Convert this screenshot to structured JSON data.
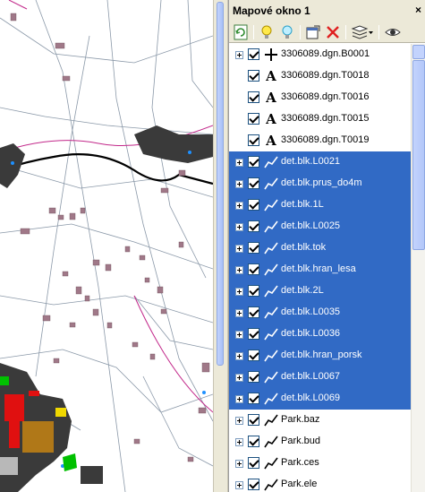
{
  "panel": {
    "title": "Mapové okno 1",
    "close_symbol": "×"
  },
  "toolbar": {
    "buttons": [
      {
        "name": "refresh-icon"
      },
      {
        "name": "lightbulb-on-icon"
      },
      {
        "name": "lightbulb-off-icon"
      },
      {
        "name": "properties-icon"
      },
      {
        "name": "delete-icon"
      },
      {
        "name": "layers-dropdown-icon"
      },
      {
        "name": "eye-icon"
      }
    ]
  },
  "layers": [
    {
      "label": "3306089.dgn.B0001",
      "icon": "point-cross-icon",
      "expandable": true,
      "checked": true,
      "selected": false
    },
    {
      "label": "3306089.dgn.T0018",
      "icon": "text-layer-icon",
      "expandable": false,
      "checked": true,
      "selected": false
    },
    {
      "label": "3306089.dgn.T0016",
      "icon": "text-layer-icon",
      "expandable": false,
      "checked": true,
      "selected": false
    },
    {
      "label": "3306089.dgn.T0015",
      "icon": "text-layer-icon",
      "expandable": false,
      "checked": true,
      "selected": false
    },
    {
      "label": "3306089.dgn.T0019",
      "icon": "text-layer-icon",
      "expandable": false,
      "checked": true,
      "selected": false
    },
    {
      "label": "det.blk.L0021",
      "icon": "line-layer-icon",
      "expandable": true,
      "checked": true,
      "selected": true
    },
    {
      "label": "det.blk.prus_do4m",
      "icon": "line-layer-icon",
      "expandable": true,
      "checked": true,
      "selected": true
    },
    {
      "label": "det.blk.1L",
      "icon": "line-layer-icon",
      "expandable": true,
      "checked": true,
      "selected": true
    },
    {
      "label": "det.blk.L0025",
      "icon": "line-layer-icon",
      "expandable": true,
      "checked": true,
      "selected": true
    },
    {
      "label": "det.blk.tok",
      "icon": "line-layer-icon",
      "expandable": true,
      "checked": true,
      "selected": true
    },
    {
      "label": "det.blk.hran_lesa",
      "icon": "line-layer-icon",
      "expandable": true,
      "checked": true,
      "selected": true
    },
    {
      "label": "det.blk.2L",
      "icon": "line-layer-icon",
      "expandable": true,
      "checked": true,
      "selected": true
    },
    {
      "label": "det.blk.L0035",
      "icon": "line-layer-icon",
      "expandable": true,
      "checked": true,
      "selected": true
    },
    {
      "label": "det.blk.L0036",
      "icon": "line-layer-icon",
      "expandable": true,
      "checked": true,
      "selected": true
    },
    {
      "label": "det.blk.hran_porsk",
      "icon": "line-layer-icon",
      "expandable": true,
      "checked": true,
      "selected": true
    },
    {
      "label": "det.blk.L0067",
      "icon": "line-layer-icon",
      "expandable": true,
      "checked": true,
      "selected": true
    },
    {
      "label": "det.blk.L0069",
      "icon": "line-layer-icon",
      "expandable": true,
      "checked": true,
      "selected": true
    },
    {
      "label": "Park.baz",
      "icon": "line-layer-icon",
      "expandable": true,
      "checked": true,
      "selected": false
    },
    {
      "label": "Park.bud",
      "icon": "line-layer-icon",
      "expandable": true,
      "checked": true,
      "selected": false
    },
    {
      "label": "Park.ces",
      "icon": "line-layer-icon",
      "expandable": true,
      "checked": true,
      "selected": false
    },
    {
      "label": "Park.ele",
      "icon": "line-layer-icon",
      "expandable": true,
      "checked": true,
      "selected": false
    }
  ],
  "colors": {
    "selection": "#316ac5",
    "parcel_fill": "#a07888",
    "forest_fill": "#3a3a3a",
    "boundary": "#c2288a",
    "water": "#1e90ff"
  }
}
